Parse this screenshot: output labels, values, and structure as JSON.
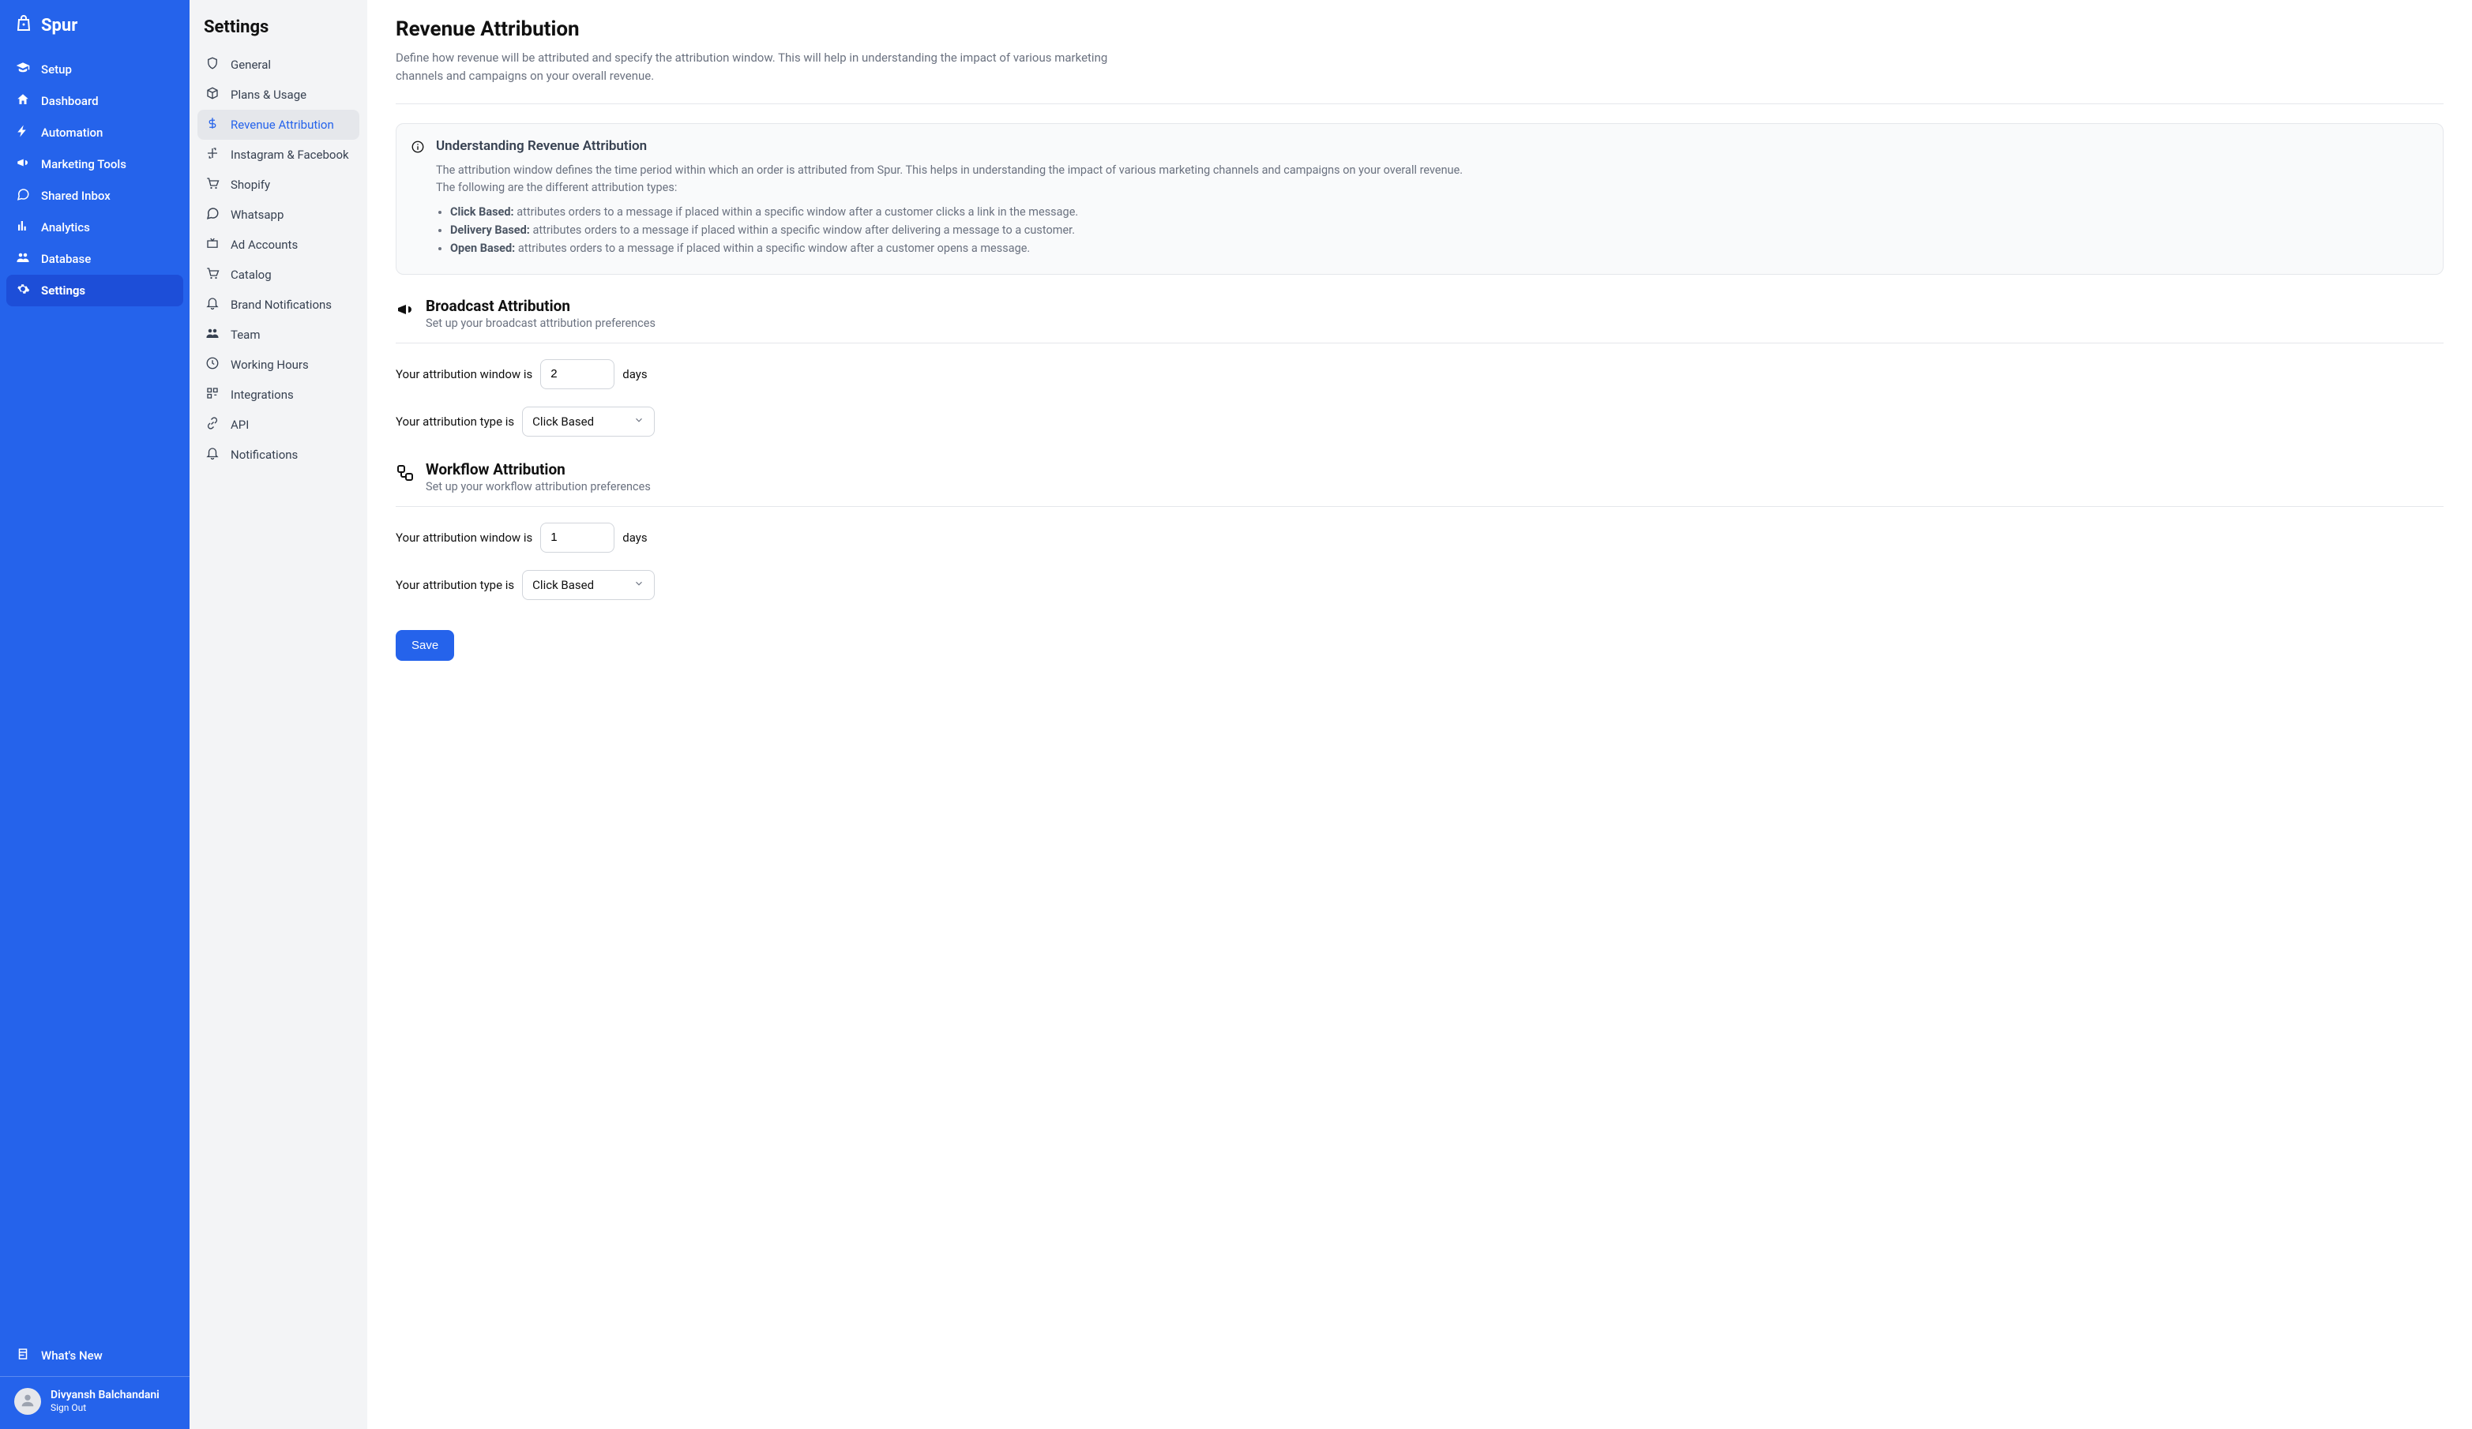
{
  "app": {
    "name": "Spur"
  },
  "nav": {
    "items": [
      {
        "label": "Setup",
        "icon": "grad-cap"
      },
      {
        "label": "Dashboard",
        "icon": "home"
      },
      {
        "label": "Automation",
        "icon": "bolt"
      },
      {
        "label": "Marketing Tools",
        "icon": "megaphone"
      },
      {
        "label": "Shared Inbox",
        "icon": "chat"
      },
      {
        "label": "Analytics",
        "icon": "bars"
      },
      {
        "label": "Database",
        "icon": "people"
      },
      {
        "label": "Settings",
        "icon": "gear",
        "active": true
      }
    ],
    "whatsNew": "What's New"
  },
  "user": {
    "name": "Divyansh Balchandani",
    "signOut": "Sign Out"
  },
  "subnav": {
    "title": "Settings",
    "items": [
      {
        "label": "General",
        "icon": "shield"
      },
      {
        "label": "Plans & Usage",
        "icon": "box"
      },
      {
        "label": "Revenue Attribution",
        "icon": "dollar",
        "active": true
      },
      {
        "label": "Instagram & Facebook",
        "icon": "social"
      },
      {
        "label": "Shopify",
        "icon": "cart"
      },
      {
        "label": "Whatsapp",
        "icon": "chat"
      },
      {
        "label": "Ad Accounts",
        "icon": "tv"
      },
      {
        "label": "Catalog",
        "icon": "cart"
      },
      {
        "label": "Brand Notifications",
        "icon": "bell"
      },
      {
        "label": "Team",
        "icon": "people"
      },
      {
        "label": "Working Hours",
        "icon": "clock"
      },
      {
        "label": "Integrations",
        "icon": "grid"
      },
      {
        "label": "API",
        "icon": "link"
      },
      {
        "label": "Notifications",
        "icon": "bell"
      }
    ]
  },
  "page": {
    "title": "Revenue Attribution",
    "description": "Define how revenue will be attributed and specify the attribution window. This will help in understanding the impact of various marketing channels and campaigns on your overall revenue."
  },
  "info": {
    "title": "Understanding Revenue Attribution",
    "p1": "The attribution window defines the time period within which an order is attributed from Spur. This helps in understanding the impact of various marketing channels and campaigns on your overall revenue.",
    "p2": "The following are the different attribution types:",
    "items": [
      {
        "term": "Click Based:",
        "desc": "attributes orders to a message if placed within a specific window after a customer clicks a link in the message."
      },
      {
        "term": "Delivery Based:",
        "desc": "attributes orders to a message if placed within a specific window after delivering a message to a customer."
      },
      {
        "term": "Open Based:",
        "desc": "attributes orders to a message if placed within a specific window after a customer opens a message."
      }
    ]
  },
  "broadcast": {
    "title": "Broadcast Attribution",
    "subtitle": "Set up your broadcast attribution preferences",
    "windowLabelPre": "Your attribution window is",
    "windowValue": "2",
    "windowLabelPost": "days",
    "typeLabel": "Your attribution type is",
    "typeValue": "Click Based"
  },
  "workflow": {
    "title": "Workflow Attribution",
    "subtitle": "Set up your workflow attribution preferences",
    "windowLabelPre": "Your attribution window is",
    "windowValue": "1",
    "windowLabelPost": "days",
    "typeLabel": "Your attribution type is",
    "typeValue": "Click Based"
  },
  "buttons": {
    "save": "Save"
  }
}
